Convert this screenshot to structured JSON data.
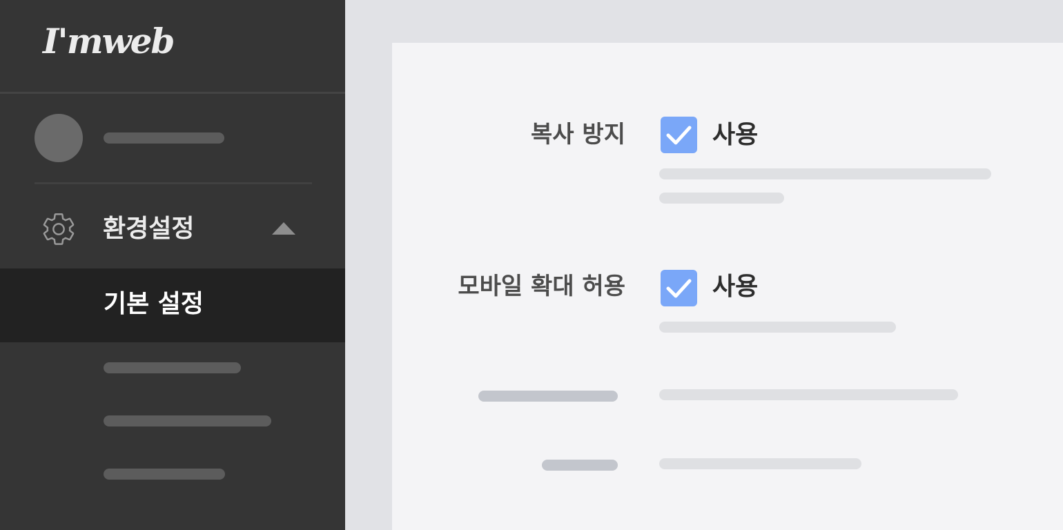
{
  "sidebar": {
    "logo_text": "I'mweb",
    "settings_menu": {
      "label": "환경설정",
      "icon": "gear-icon",
      "expanded_icon": "caret-up-icon"
    },
    "submenu_active_label": "기본 설정"
  },
  "settings": {
    "copy_protection": {
      "label": "복사 방지",
      "checkbox_label": "사용",
      "checked": true
    },
    "mobile_zoom": {
      "label": "모바일 확대 허용",
      "checkbox_label": "사용",
      "checked": true
    }
  },
  "colors": {
    "sidebar_bg": "#353535",
    "sidebar_active_bg": "#222222",
    "checkbox_accent": "#7aa7f8",
    "page_bg": "#e1e2e6",
    "panel_bg": "#f4f4f6"
  }
}
